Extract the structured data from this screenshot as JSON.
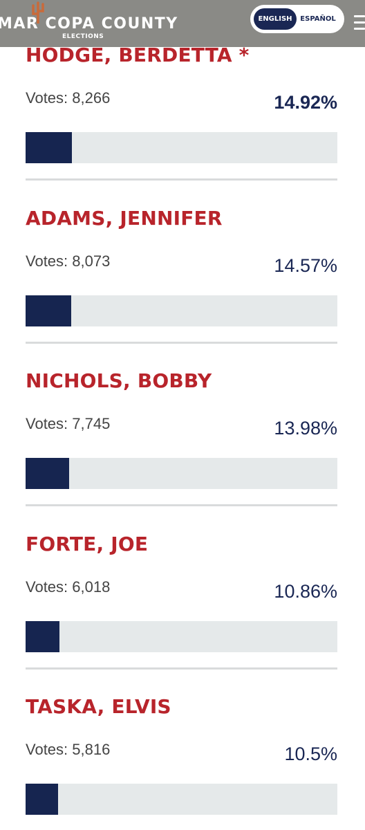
{
  "header": {
    "logo_text": "MAR COPA COUNTY",
    "logo_sub": "ELECTIONS",
    "lang_active": "ENGLISH",
    "lang_inactive": "ESPAÑOL",
    "background": "#8a8a86"
  },
  "candidates": [
    {
      "name": "HODGE, BERDETTA *",
      "votes_label": "Votes: 8,266",
      "pct": "14.92%",
      "fill_percent": 14.92,
      "leader": true
    },
    {
      "name": "ADAMS, JENNIFER",
      "votes_label": "Votes: 8,073",
      "pct": "14.57%",
      "fill_percent": 14.57,
      "leader": false
    },
    {
      "name": "NICHOLS, BOBBY",
      "votes_label": "Votes: 7,745",
      "pct": "13.98%",
      "fill_percent": 13.98,
      "leader": false
    },
    {
      "name": "FORTE, JOE",
      "votes_label": "Votes: 6,018",
      "pct": "10.86%",
      "fill_percent": 10.86,
      "leader": false
    },
    {
      "name": "TASKA, ELVIS",
      "votes_label": "Votes: 5,816",
      "pct": "10.5%",
      "fill_percent": 10.5,
      "leader": false
    }
  ],
  "colors": {
    "name_red": "#b8242b",
    "navy": "#1a2754",
    "bar_track": "#e5e9ea"
  }
}
